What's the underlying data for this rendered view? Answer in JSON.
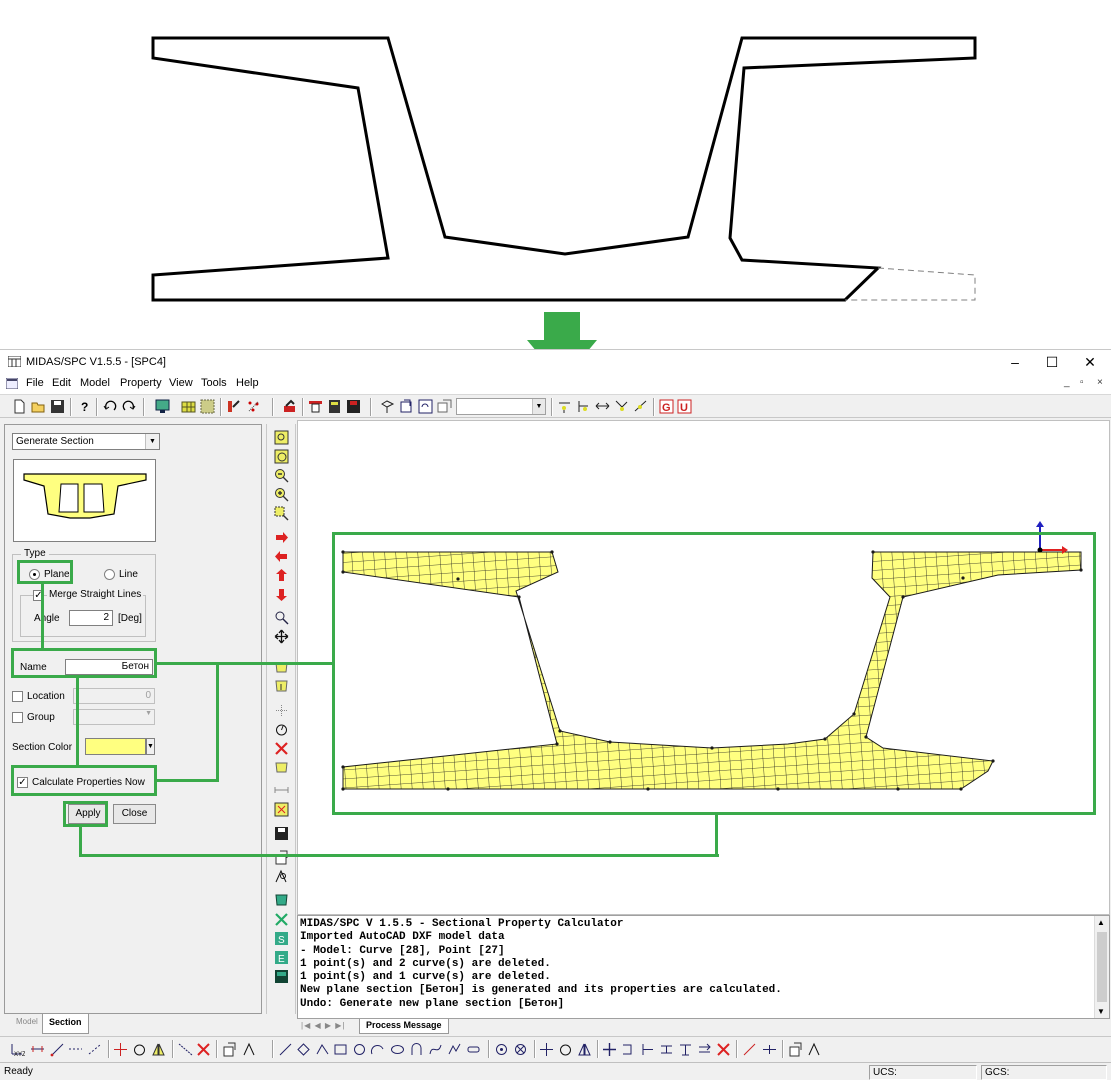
{
  "window": {
    "title": "MIDAS/SPC V1.5.5 - [SPC4]",
    "controls": [
      "–",
      "☐",
      "✕"
    ]
  },
  "menu": {
    "items": [
      {
        "label": "File",
        "accel": "F"
      },
      {
        "label": "Edit",
        "accel": "E"
      },
      {
        "label": "Model",
        "accel": "M"
      },
      {
        "label": "Property",
        "accel": "P"
      },
      {
        "label": "View",
        "accel": "V"
      },
      {
        "label": "Tools",
        "accel": "T"
      },
      {
        "label": "Help",
        "accel": "H"
      }
    ]
  },
  "left_panel": {
    "mode_select": "Generate Section",
    "type_group": {
      "legend": "Type",
      "plane_label": "Plane",
      "plane_checked": true,
      "line_label": "Line",
      "line_checked": false,
      "merge_label": "Merge Straight Lines",
      "merge_checked": true,
      "angle_label": "Angle",
      "angle_value": "2",
      "angle_unit": "[Deg]"
    },
    "name_label": "Name",
    "name_value": "Бетон",
    "location_label": "Location",
    "location_value": "0",
    "location_checked": false,
    "group_label": "Group",
    "group_checked": false,
    "section_color_label": "Section Color",
    "section_color": "#ffff80",
    "calc_label": "Calculate Properties Now",
    "calc_checked": true,
    "apply_label": "Apply",
    "close_label": "Close",
    "tabs": [
      "Model",
      "Section"
    ],
    "active_tab": "Section"
  },
  "messages": {
    "lines": [
      "MIDAS/SPC V 1.5.5 - Sectional Property Calculator",
      "Imported AutoCAD DXF model data",
      "- Model: Curve [28], Point [27]",
      "1 point(s) and 2 curve(s) are deleted.",
      "1 point(s) and 1 curve(s) are deleted.",
      "New plane section [Бетон] is generated and its properties are calculated.",
      "Undo: Generate new plane section [Бетон]"
    ],
    "tab_label": "Process Message"
  },
  "status": {
    "ready": "Ready",
    "ucs": "UCS:",
    "gcs": "GCS:"
  },
  "colors": {
    "callout": "#3aaa4a",
    "arrow": "#3aaa4a",
    "mesh_fill": "#ffff80",
    "axis_x": "#e02020",
    "axis_y": "#2020c0"
  },
  "icons": {
    "down_arrow": "green-down-arrow",
    "toolbar_main": [
      "new-icon",
      "open-icon",
      "save-icon",
      "help-icon",
      "undo-icon",
      "redo-icon",
      "display-icon",
      "grid-icon",
      "snap-icon",
      "paint-icon",
      "points-icon",
      "tool-icon",
      "table-icon",
      "calc-icon",
      "save2-icon",
      "rotate-icon",
      "view-icon",
      "refresh-icon",
      "window-icon",
      "node-icon",
      "curve-icon",
      "move-icon",
      "edit-icon",
      "split-icon",
      "g-icon",
      "u-icon"
    ]
  }
}
